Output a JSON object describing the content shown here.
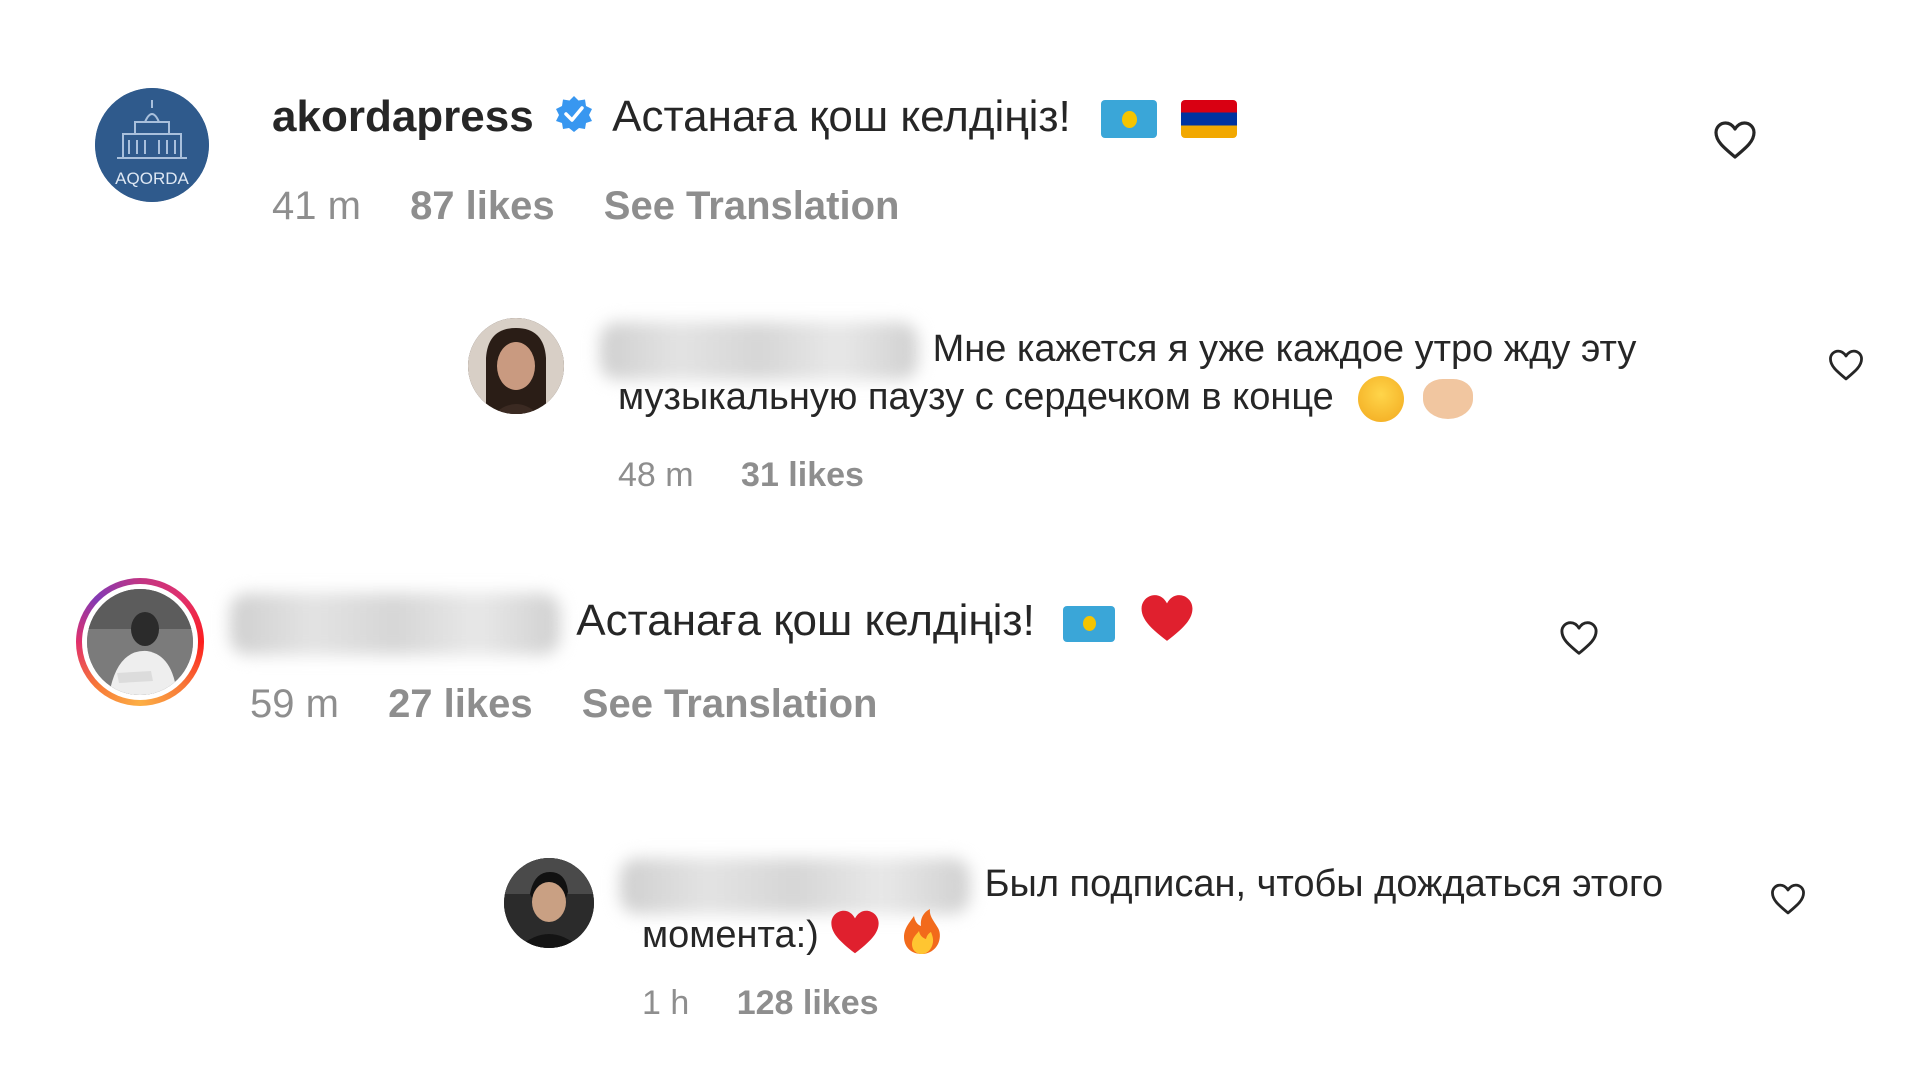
{
  "comments": [
    {
      "username": "akordapress",
      "avatar_text": "AQORDA",
      "text": "Астанаға қош келдіңіз!",
      "time": "41 m",
      "likes": "87 likes",
      "translation": "See Translation"
    },
    {
      "text_line1": "Мне кажется я уже каждое утро жду эту",
      "text_line2": "музыкальную паузу с сердечком в конце",
      "time": "48 m",
      "likes": "31 likes"
    },
    {
      "text": "Астанаға қош келдіңіз!",
      "time": "59 m",
      "likes": "27 likes",
      "translation": "See Translation"
    },
    {
      "text_line1": "Был подписан, чтобы дождаться этого",
      "text_line2": "момента:)",
      "time": "1 h",
      "likes": "128 likes"
    }
  ],
  "colors": {
    "text": "#262626",
    "meta": "#8e8e8e",
    "verified": "#3897f0",
    "akorda_avatar": "#2f5a8c"
  },
  "icons": [
    "heart-icon",
    "verified-badge-icon",
    "kazakhstan-flag-icon",
    "armenia-flag-icon",
    "laughing-emoji-icon",
    "heart-hands-emoji-icon",
    "red-heart-emoji-icon",
    "fire-emoji-icon"
  ]
}
